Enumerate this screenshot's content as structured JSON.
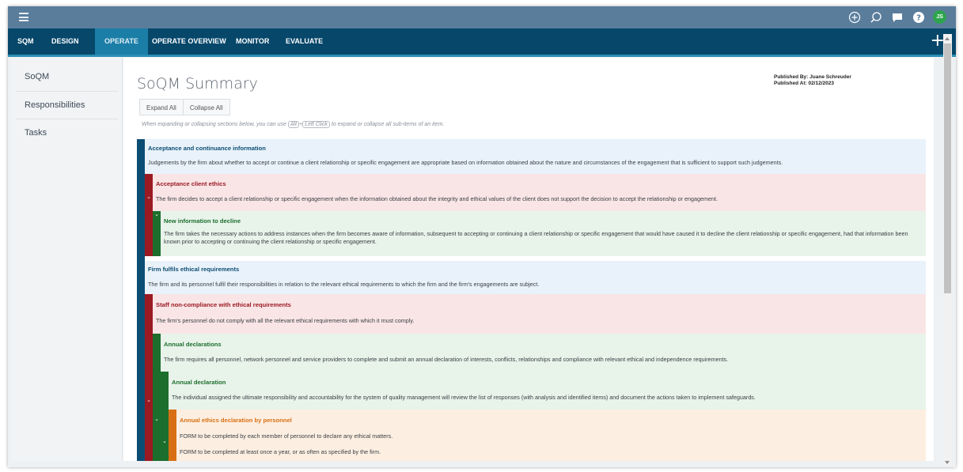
{
  "topbar": {
    "avatar_initials": "JS"
  },
  "nav": {
    "items": [
      {
        "label": "SQM"
      },
      {
        "label": "DESIGN"
      },
      {
        "label": "OPERATE"
      },
      {
        "label": "OPERATE OVERVIEW"
      },
      {
        "label": "MONITOR"
      },
      {
        "label": "EVALUATE"
      }
    ],
    "active": "OPERATE",
    "plus": "+"
  },
  "sidebar": {
    "items": [
      {
        "label": "SoQM"
      },
      {
        "label": "Responsibilities"
      },
      {
        "label": "Tasks"
      }
    ]
  },
  "main": {
    "title": "SoQM Summary",
    "published_by": "Published By: Juane Schreuder",
    "published_at": "Published At: 02/12/2023",
    "expand_all": "Expand All",
    "collapse_all": "Collapse All",
    "hint_before": "When expanding or collapsing sections below, you can use",
    "hint_key1": "Alt",
    "hint_plus": "+",
    "hint_key2": "Left Click",
    "hint_after": "to expand or collapse all sub-items of an item."
  },
  "items": [
    {
      "level": "objective",
      "title": "Acceptance and continuance information",
      "description": "Judgements by the firm about whether to accept or continue a client relationship or specific engagement are appropriate based on information obtained about the nature and circumstances of the engagement that is sufficient to support such judgements."
    },
    {
      "level": "risk",
      "title": "Acceptance client ethics",
      "description": "The firm decides to accept a client relationship or specific engagement when the information obtained about the integrity and ethical values of the client does not support the decision to accept the relationship or engagement."
    },
    {
      "level": "response",
      "title": "New information to decline",
      "description": "The firm takes the necessary actions to address instances when the firm becomes aware of information, subsequent to accepting or continuing a client relationship or specific engagement that would have caused it to decline the client relationship or specific engagement, had that information been known prior to accepting or continuing the client relationship or specific engagement."
    },
    {
      "level": "objective",
      "title": "Firm fulfils ethical requirements",
      "description": "The firm and its personnel fulfil their responsibilities in relation to the relevant ethical requirements to which the firm and the firm's engagements are subject."
    },
    {
      "level": "risk",
      "title": "Staff non-compliance with ethical requirements",
      "description": "The firm's personnel do not comply with all the relevant ethical requirements with which it must comply."
    },
    {
      "level": "response",
      "title": "Annual declarations",
      "description": "The firm requires all personnel, network personnel and service providers to complete and submit an annual declaration of interests, conflicts, relationships and compliance with relevant ethical and independence requirements."
    },
    {
      "level": "response",
      "title": "Annual declaration",
      "description": "The individual assigned the ultimate responsibility and accountability for the system of quality management will review the list of responses (with analysis and identified items) and document the actions taken to implement safeguards."
    },
    {
      "level": "task",
      "title": "Annual ethics declaration by personnel",
      "lines": [
        "FORM to be completed by each member of personnel to declare any ethical matters.",
        "FORM to be completed at least once a year, or as often as specified by the firm."
      ]
    }
  ],
  "colors": {
    "objective_bar": "#0c4d73",
    "objective_bg": "#e9f2fa",
    "objective_title": "#0c4d73",
    "risk_bar": "#9b1a22",
    "risk_bg": "#f9e5e6",
    "risk_title": "#9b1a22",
    "response_bar": "#1c6e2c",
    "response_bg": "#e8f3ea",
    "response_title": "#1c6e2c",
    "task_bar": "#d96f14",
    "task_bg": "#fcefe1",
    "task_title": "#d96f14"
  },
  "icons": [
    "menu-icon",
    "add-circle-icon",
    "search-icon",
    "chat-icon",
    "help-icon",
    "plus-icon",
    "chevron-down-icon"
  ]
}
